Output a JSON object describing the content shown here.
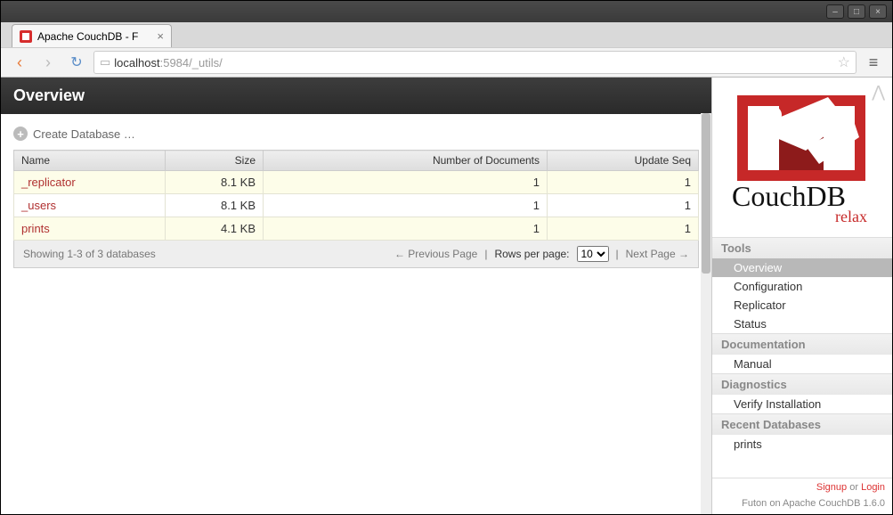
{
  "os": {
    "minimize": "–",
    "maximize": "□",
    "close": "×"
  },
  "tab": {
    "title": "Apache CouchDB - F",
    "close": "×"
  },
  "toolbar": {
    "back": "‹",
    "forward": "›",
    "reload": "↻",
    "url_prefix": "localhost",
    "url_port_path": ":5984/_utils/",
    "star": "☆",
    "menu": "≡"
  },
  "main": {
    "heading": "Overview",
    "create_label": "Create Database …",
    "columns": {
      "name": "Name",
      "size": "Size",
      "docs": "Number of Documents",
      "seq": "Update Seq"
    },
    "rows": [
      {
        "name": "_replicator",
        "size": "8.1 KB",
        "docs": "1",
        "seq": "1"
      },
      {
        "name": "_users",
        "size": "8.1 KB",
        "docs": "1",
        "seq": "1"
      },
      {
        "name": "prints",
        "size": "4.1 KB",
        "docs": "1",
        "seq": "1"
      }
    ],
    "footer": {
      "showing": "Showing 1-3 of 3 databases",
      "prev": "← Previous Page",
      "sep": "|",
      "rows_label": "Rows per page:",
      "rows_value": "10",
      "next": "Next Page →"
    }
  },
  "sidebar": {
    "collapse": "⋀",
    "logo_text1": "CouchDB",
    "logo_text2": "relax",
    "sections": [
      {
        "title": "Tools",
        "items": [
          {
            "label": "Overview",
            "active": true
          },
          {
            "label": "Configuration"
          },
          {
            "label": "Replicator"
          },
          {
            "label": "Status"
          }
        ]
      },
      {
        "title": "Documentation",
        "items": [
          {
            "label": "Manual"
          }
        ]
      },
      {
        "title": "Diagnostics",
        "items": [
          {
            "label": "Verify Installation"
          }
        ]
      },
      {
        "title": "Recent Databases",
        "items": [
          {
            "label": "prints"
          }
        ]
      }
    ],
    "footer": {
      "signup": "Signup",
      "or": " or ",
      "login": "Login",
      "version": "Futon on Apache CouchDB 1.6.0"
    }
  }
}
